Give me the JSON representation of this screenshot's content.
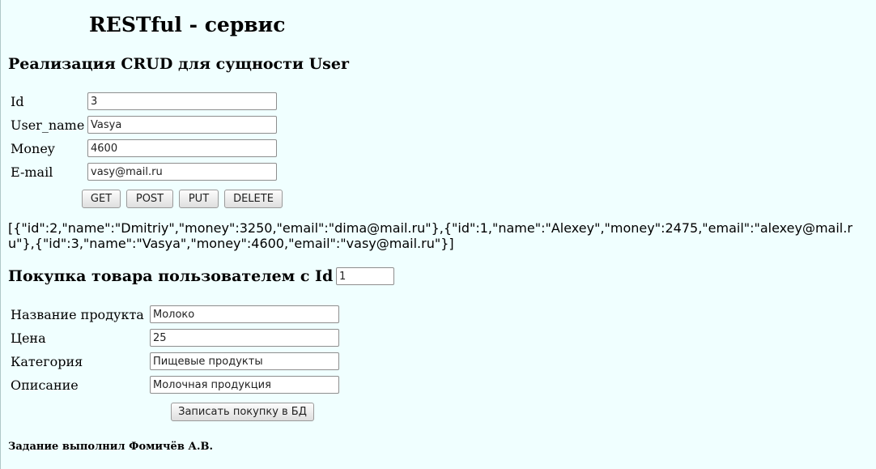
{
  "page_title": "RESTful - сервис",
  "crud_section": {
    "title": "Реализация CRUD для сущности User",
    "fields": {
      "id": {
        "label": "Id",
        "value": "3"
      },
      "user_name": {
        "label": "User_name",
        "value": "Vasya"
      },
      "money": {
        "label": "Money",
        "value": "4600"
      },
      "email": {
        "label": "E-mail",
        "value": "vasy@mail.ru"
      }
    },
    "buttons": {
      "get": "GET",
      "post": "POST",
      "put": "PUT",
      "delete": "DELETE"
    }
  },
  "json_output": "[{\"id\":2,\"name\":\"Dmitriy\",\"money\":3250,\"email\":\"dima@mail.ru\"},{\"id\":1,\"name\":\"Alexey\",\"money\":2475,\"email\":\"alexey@mail.ru\"},{\"id\":3,\"name\":\"Vasya\",\"money\":4600,\"email\":\"vasy@mail.ru\"}]",
  "purchase_section": {
    "title": "Покупка товара пользователем с Id",
    "user_id": "1",
    "fields": {
      "product_name": {
        "label": "Название продукта",
        "value": "Молоко"
      },
      "price": {
        "label": "Цена",
        "value": "25"
      },
      "category": {
        "label": "Категория",
        "value": "Пищевые продукты"
      },
      "description": {
        "label": "Описание",
        "value": "Молочная продукция"
      }
    },
    "submit_label": "Записать покупку в БД"
  },
  "footer": "Задание выполнил Фомичёв А.В."
}
